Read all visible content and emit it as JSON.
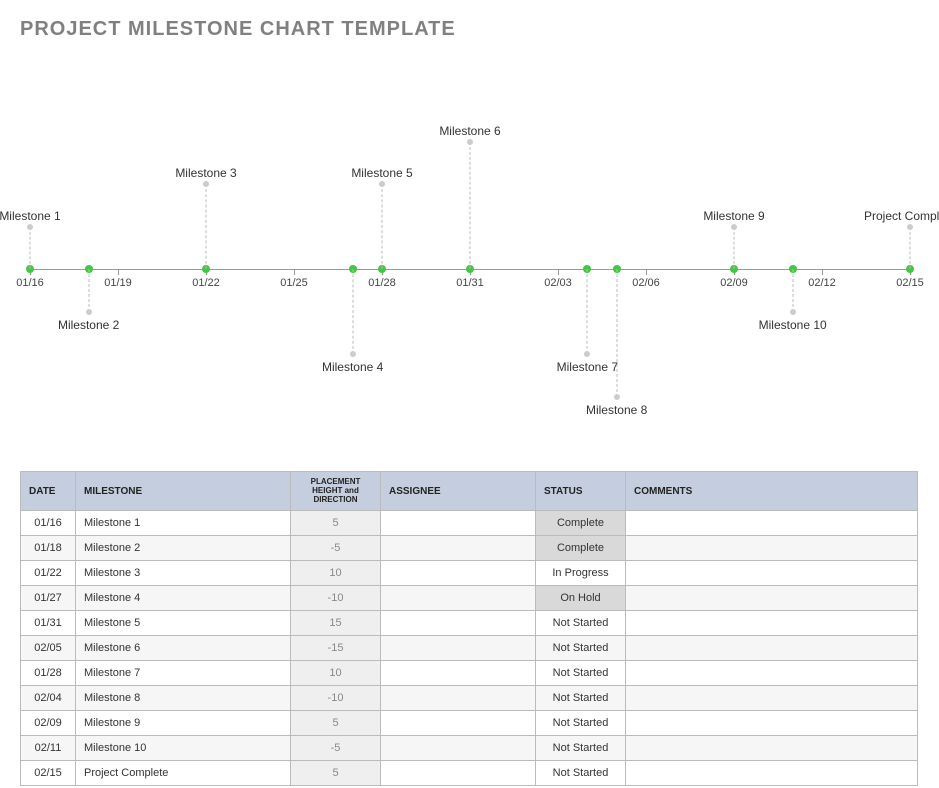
{
  "title": "PROJECT MILESTONE CHART TEMPLATE",
  "chart_data": {
    "type": "scatter",
    "title": "",
    "xlabel": "",
    "ylabel": "",
    "ylim": [
      -20,
      20
    ],
    "x_ticks": [
      "01/16",
      "01/19",
      "01/22",
      "01/25",
      "01/28",
      "01/31",
      "02/03",
      "02/06",
      "02/09",
      "02/12",
      "02/15"
    ],
    "x_range": [
      "01/16",
      "02/15"
    ],
    "series": [
      {
        "name": "Milestone 1",
        "x": "01/16",
        "y": 5
      },
      {
        "name": "Milestone 2",
        "x": "01/18",
        "y": -5
      },
      {
        "name": "Milestone 3",
        "x": "01/22",
        "y": 10
      },
      {
        "name": "Milestone 4",
        "x": "01/27",
        "y": -10
      },
      {
        "name": "Milestone 5",
        "x": "01/28",
        "y": 10
      },
      {
        "name": "Milestone 6",
        "x": "01/31",
        "y": 15
      },
      {
        "name": "Milestone 7",
        "x": "02/04",
        "y": -10
      },
      {
        "name": "Milestone 8",
        "x": "02/05",
        "y": -15
      },
      {
        "name": "Milestone 9",
        "x": "02/09",
        "y": 5
      },
      {
        "name": "Milestone 10",
        "x": "02/11",
        "y": -5
      },
      {
        "name": "Project Complete",
        "x": "02/15",
        "y": 5
      }
    ]
  },
  "table": {
    "headers": {
      "date": "DATE",
      "milestone": "MILESTONE",
      "placement": "PLACEMENT HEIGHT and DIRECTION",
      "assignee": "ASSIGNEE",
      "status": "STATUS",
      "comments": "COMMENTS"
    },
    "rows": [
      {
        "date": "01/16",
        "milestone": "Milestone 1",
        "placement": "5",
        "assignee": "",
        "status": "Complete",
        "comments": ""
      },
      {
        "date": "01/18",
        "milestone": "Milestone 2",
        "placement": "-5",
        "assignee": "",
        "status": "Complete",
        "comments": ""
      },
      {
        "date": "01/22",
        "milestone": "Milestone 3",
        "placement": "10",
        "assignee": "",
        "status": "In Progress",
        "comments": ""
      },
      {
        "date": "01/27",
        "milestone": "Milestone 4",
        "placement": "-10",
        "assignee": "",
        "status": "On Hold",
        "comments": ""
      },
      {
        "date": "01/31",
        "milestone": "Milestone 5",
        "placement": "15",
        "assignee": "",
        "status": "Not Started",
        "comments": ""
      },
      {
        "date": "02/05",
        "milestone": "Milestone 6",
        "placement": "-15",
        "assignee": "",
        "status": "Not Started",
        "comments": ""
      },
      {
        "date": "01/28",
        "milestone": "Milestone 7",
        "placement": "10",
        "assignee": "",
        "status": "Not Started",
        "comments": ""
      },
      {
        "date": "02/04",
        "milestone": "Milestone 8",
        "placement": "-10",
        "assignee": "",
        "status": "Not Started",
        "comments": ""
      },
      {
        "date": "02/09",
        "milestone": "Milestone 9",
        "placement": "5",
        "assignee": "",
        "status": "Not Started",
        "comments": ""
      },
      {
        "date": "02/11",
        "milestone": "Milestone 10",
        "placement": "-5",
        "assignee": "",
        "status": "Not Started",
        "comments": ""
      },
      {
        "date": "02/15",
        "milestone": "Project Complete",
        "placement": "5",
        "assignee": "",
        "status": "Not Started",
        "comments": ""
      }
    ]
  }
}
